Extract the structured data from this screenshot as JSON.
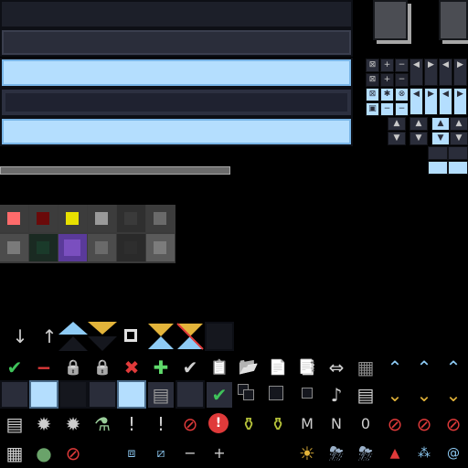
{
  "colors": {
    "background": "#000000",
    "bar_dark": "#1c1f29",
    "bar_light": "#b4defe",
    "accent_green": "#3fc35a",
    "accent_red": "#e03a3a",
    "accent_blue": "#8ecbf5",
    "accent_gold": "#e3b43a"
  },
  "palette": [
    "#ff6b6b",
    "#6a0a0a",
    "#e8e000",
    "#9a9a9a",
    "#3a3a3a",
    "#6a6a6a",
    "#7a7a7a",
    "#1a3a2a",
    "#7a4fbf",
    "#6a6a6a",
    "#2e2e2e",
    "#7c7c7c"
  ],
  "tiles": {
    "row1": [
      "⊠",
      "+",
      "−",
      "◀",
      "▶",
      "◀",
      "▶"
    ],
    "row2": [
      "⊠",
      "+",
      "−",
      "◀",
      "▶",
      "◀",
      "▶"
    ],
    "row3": [
      "⊠",
      "✱",
      "⊗",
      "◀",
      "▶",
      "◀",
      "▶"
    ],
    "row4": [
      "▣",
      "−",
      "−",
      "◀",
      "▶",
      "◀",
      "▶"
    ]
  },
  "icons": {
    "row1": [
      "↓",
      "↑",
      "▲",
      "▼",
      "□",
      "⧗",
      "⧖",
      "■"
    ],
    "row2": [
      "✔",
      "−",
      "🔒",
      "🔒",
      "✖",
      "✚",
      "✔",
      "📋",
      "📂",
      "📄",
      "📑",
      "⇔",
      "▦",
      "⌃",
      "⌃",
      "⌃"
    ],
    "row3": [
      "■",
      "■",
      "■",
      "■",
      "■",
      "▤",
      "■",
      "✔",
      "▪",
      "▪",
      "▪",
      "♪",
      "▤",
      "⌄",
      "⌄",
      "⌄"
    ],
    "row4": [
      "▤",
      "✹",
      "✹",
      "⚗",
      "!",
      "!",
      "⊘",
      "!",
      "⚱",
      "⚱",
      "M",
      "N",
      "0",
      "⊘",
      "⊘",
      "⊘"
    ],
    "row5": [
      "▦",
      "●",
      "⊘",
      "",
      "",
      "⧈",
      "⧄",
      "−",
      "+",
      "",
      "",
      "☀",
      "⛈",
      "⛈",
      "▲",
      "⁂",
      "@"
    ]
  }
}
